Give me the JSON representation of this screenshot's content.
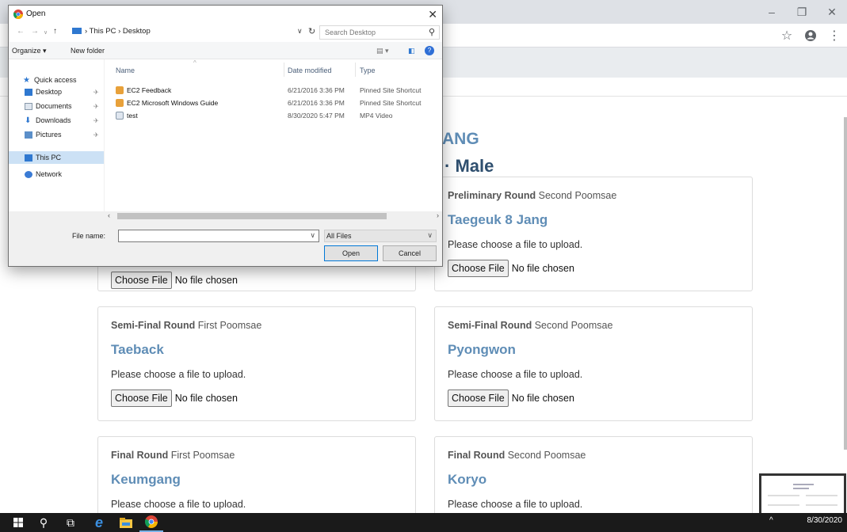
{
  "browser": {
    "window_controls": [
      "–",
      "❐",
      "✕"
    ],
    "toolbar_icons": [
      "star-icon",
      "profile-icon",
      "more-icon"
    ]
  },
  "page": {
    "name_heading": "ANG",
    "category_heading": "Male"
  },
  "cards": [
    {
      "round_bold": "Preliminary Round",
      "round_rest": " Second Poomsae",
      "form": "Taegeuk 8 Jang",
      "hint": "Please choose a file to upload.",
      "button": "Choose File",
      "status": "No file chosen"
    },
    {
      "round_bold": "",
      "round_rest": "",
      "form": "",
      "hint": "",
      "button": "Choose File",
      "status": "No file chosen"
    },
    {
      "round_bold": "Semi-Final Round",
      "round_rest": " First Poomsae",
      "form": "Taeback",
      "hint": "Please choose a file to upload.",
      "button": "Choose File",
      "status": "No file chosen"
    },
    {
      "round_bold": "Semi-Final Round",
      "round_rest": " Second Poomsae",
      "form": "Pyongwon",
      "hint": "Please choose a file to upload.",
      "button": "Choose File",
      "status": "No file chosen"
    },
    {
      "round_bold": "Final Round",
      "round_rest": " First Poomsae",
      "form": "Keumgang",
      "hint": "Please choose a file to upload."
    },
    {
      "round_bold": "Final Round",
      "round_rest": " Second Poomsae",
      "form": "Koryo",
      "hint": "Please choose a file to upload."
    }
  ],
  "dialog": {
    "title": "Open",
    "path": [
      "This PC",
      "Desktop"
    ],
    "search_placeholder": "Search Desktop",
    "organize": "Organize ▾",
    "new_folder": "New folder",
    "nav": {
      "quick_access": "Quick access",
      "desktop": "Desktop",
      "documents": "Documents",
      "downloads": "Downloads",
      "pictures": "Pictures",
      "this_pc": "This PC",
      "network": "Network"
    },
    "columns": {
      "name": "Name",
      "date": "Date modified",
      "type": "Type"
    },
    "files": [
      {
        "name": "EC2 Feedback",
        "date": "6/21/2016 3:36 PM",
        "type": "Pinned Site Shortcut"
      },
      {
        "name": "EC2 Microsoft Windows Guide",
        "date": "6/21/2016 3:36 PM",
        "type": "Pinned Site Shortcut"
      },
      {
        "name": "test",
        "date": "8/30/2020 5:47 PM",
        "type": "MP4 Video"
      }
    ],
    "file_name_label": "File name:",
    "file_name_value": "",
    "file_type": "All Files",
    "open_button": "Open",
    "cancel_button": "Cancel"
  },
  "taskbar": {
    "clock_date": "8/30/2020"
  }
}
